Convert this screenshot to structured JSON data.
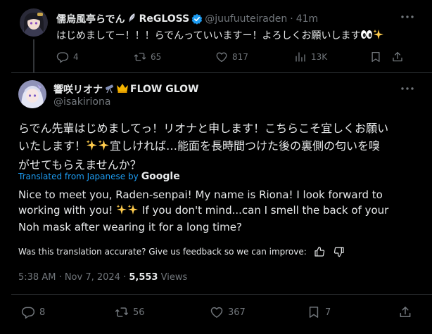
{
  "parent_post": {
    "display_name": "儒烏風亭らでん",
    "group_name": "ReGLOSS",
    "handle": "@juufuuteiraden",
    "separator": "·",
    "time": "41m",
    "text": "はじめましてー！！！らでんっていいますー！よろしくお願いします",
    "replies": "4",
    "reposts": "65",
    "likes": "817",
    "views": "13K"
  },
  "main_post": {
    "display_name": "響咲リオナ",
    "group_name": "FLOW GLOW",
    "handle": "@isakiriona",
    "text_line1": "らでん先輩はじめましてっ！リオナと申します！こちらこそ宜しくお願い",
    "text_line2_a": "いたします！",
    "text_line2_b": "宜しければ…能面を長時間つけた後の裏側の匂いを嗅",
    "text_line3": "がせてもらえませんか？",
    "translated_from": "Translated from Japanese by",
    "translator": "Google",
    "translation_line1": "Nice to meet you, Raden-senpai! My name is Riona! I look forward to",
    "translation_line2_a": "working with you!",
    "translation_line2_b": "If you don't mind...can I smell the back of your",
    "translation_line3": "Noh mask after wearing it for a long time?",
    "feedback_prompt": "Was this translation accurate? Give us feedback so we can improve:",
    "timestamp": "5:38 AM · Nov 7, 2024 · ",
    "views_count": "5,553",
    "views_label": " Views",
    "replies": "8",
    "reposts": "56",
    "likes": "367",
    "bookmarks": "7"
  },
  "icons": [
    "verified-badge-icon",
    "more-icon",
    "reply-icon",
    "repost-icon",
    "like-icon",
    "views-icon",
    "bookmark-icon",
    "share-icon",
    "thumbs-up-icon",
    "thumbs-down-icon",
    "sparkles-icon",
    "eyes-icon",
    "crown-icon"
  ],
  "colors": {
    "background": "#000000",
    "text": "#e7e9ea",
    "secondary": "#71767b",
    "link": "#1d9bf0",
    "divider": "#2f3336",
    "verified": "#1d9bf0"
  }
}
